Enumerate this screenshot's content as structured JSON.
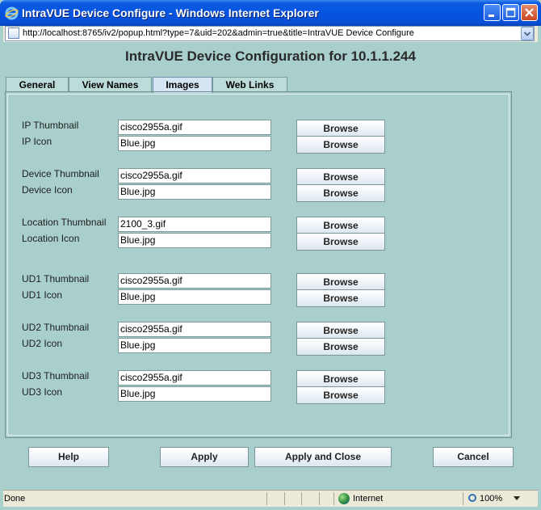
{
  "window": {
    "title": "IntraVUE Device Configure - Windows Internet Explorer",
    "address": "http://localhost:8765/iv2/popup.html?type=7&uid=202&admin=true&title=IntraVUE Device Configure"
  },
  "page": {
    "heading": "IntraVUE Device Configuration for 10.1.1.244"
  },
  "tabs": [
    {
      "label": "General"
    },
    {
      "label": "View Names"
    },
    {
      "label": "Images"
    },
    {
      "label": "Web Links"
    }
  ],
  "active_tab": "Images",
  "groups": [
    {
      "thumb_label": "IP Thumbnail",
      "thumb_value": "cisco2955a.gif",
      "icon_label": "IP  Icon",
      "icon_value": "Blue.jpg"
    },
    {
      "thumb_label": "Device Thumbnail",
      "thumb_value": "cisco2955a.gif",
      "icon_label": "Device Icon",
      "icon_value": "Blue.jpg"
    },
    {
      "thumb_label": "Location Thumbnail",
      "thumb_value": "2100_3.gif",
      "icon_label": "Location Icon",
      "icon_value": "Blue.jpg"
    },
    {
      "thumb_label": "UD1 Thumbnail",
      "thumb_value": "cisco2955a.gif",
      "icon_label": "UD1 Icon",
      "icon_value": "Blue.jpg"
    },
    {
      "thumb_label": "UD2 Thumbnail",
      "thumb_value": "cisco2955a.gif",
      "icon_label": "UD2 Icon",
      "icon_value": "Blue.jpg"
    },
    {
      "thumb_label": "UD3 Thumbnail",
      "thumb_value": "cisco2955a.gif",
      "icon_label": "UD3 Icon",
      "icon_value": "Blue.jpg"
    }
  ],
  "browse_label": "Browse",
  "buttons": {
    "help": "Help",
    "apply": "Apply",
    "apply_close": "Apply and Close",
    "cancel": "Cancel"
  },
  "status": {
    "left": "Done",
    "zone": "Internet",
    "zoom": "100%"
  },
  "colors": {
    "title_bar": "#0554e2",
    "page_background": "#a8cfcc",
    "active_tab": "#d4e4f2"
  }
}
